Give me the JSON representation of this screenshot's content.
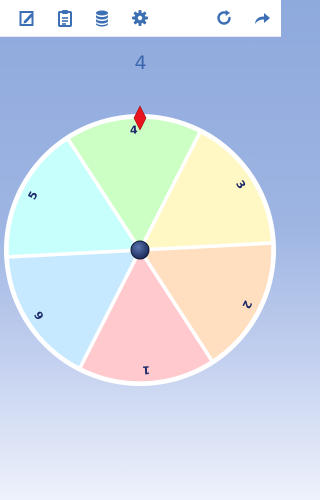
{
  "toolbar": {
    "left_icons": [
      "edit-icon",
      "clipboard-icon",
      "database-icon",
      "settings-icon"
    ],
    "right_icons": [
      "refresh-icon",
      "share-icon"
    ],
    "icon_color": "#3c6fb4"
  },
  "result": {
    "value": "4"
  },
  "wheel": {
    "segments": [
      {
        "label": "4",
        "color": "#ccffc4"
      },
      {
        "label": "3",
        "color": "#fff8c4"
      },
      {
        "label": "2",
        "color": "#ffdfc0"
      },
      {
        "label": "1",
        "color": "#ffc9cd"
      },
      {
        "label": "6",
        "color": "#c6e9ff"
      },
      {
        "label": "5",
        "color": "#c6fffb"
      }
    ],
    "rotation_deg": -3,
    "pointer_color": "#e8151f",
    "label_color": "#1f2a6b",
    "hub_color": "#1c2b58"
  }
}
